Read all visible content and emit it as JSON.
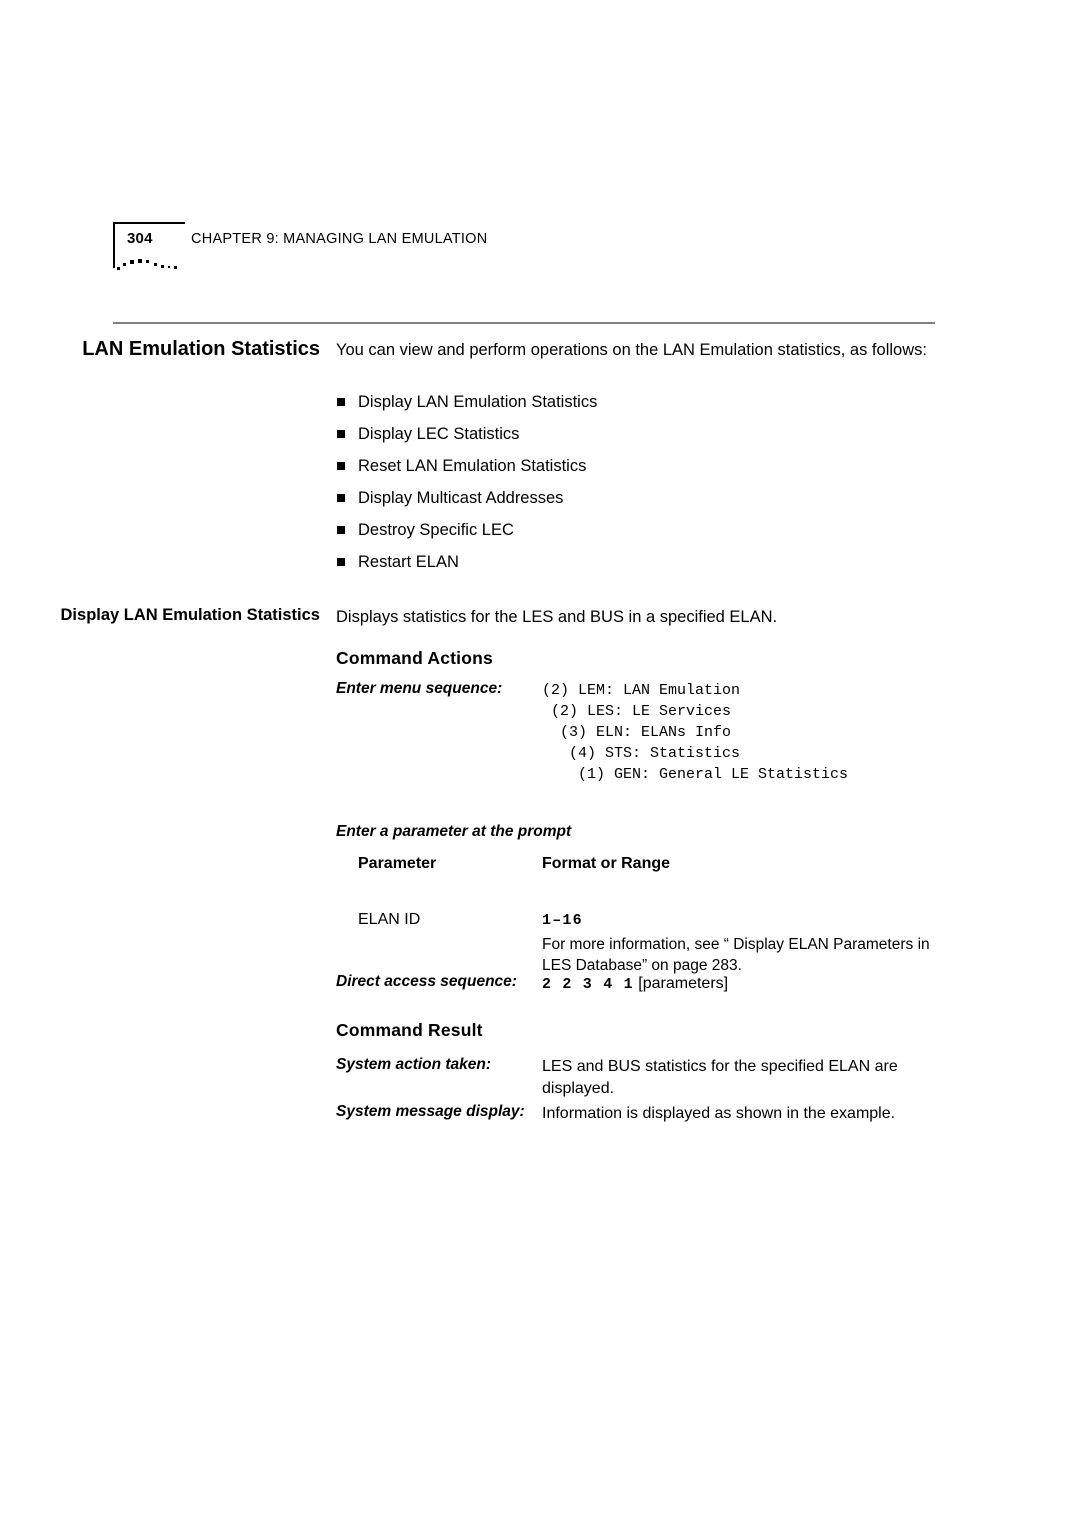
{
  "header": {
    "page_number": "304",
    "chapter_title": "CHAPTER 9: MANAGING LAN EMULATION"
  },
  "section": {
    "side_heading": "LAN Emulation Statistics",
    "intro": "You can view and perform operations on the LAN Emulation statistics, as follows:",
    "bullets": [
      {
        "label": "Display LAN Emulation Statistics"
      },
      {
        "label": "Display LEC Statistics"
      },
      {
        "label": "Reset LAN Emulation Statistics"
      },
      {
        "label": "Display Multicast Addresses"
      },
      {
        "label": "Destroy Specific LEC"
      },
      {
        "label": "Restart ELAN"
      }
    ]
  },
  "subsection": {
    "side_heading": "Display LAN Emulation Statistics",
    "description": "Displays statistics for the LES and BUS in a specified ELAN.",
    "command_actions_heading": "Command Actions",
    "menu_sequence_label": "Enter menu sequence:",
    "menu_sequence": "(2) LEM: LAN Emulation\n (2) LES: LE Services\n  (3) ELN: ELANs Info\n   (4) STS: Statistics\n    (1) GEN: General LE Statistics",
    "parameter_prompt": "Enter a parameter at the prompt",
    "table": {
      "headers": [
        "Parameter",
        "Format or Range"
      ],
      "rows": [
        {
          "parameter": "ELAN ID",
          "range": "1–16",
          "note": "For more information, see “ Display ELAN Parameters in LES Database”  on page 283."
        }
      ]
    },
    "direct_access_label": "Direct access sequence:",
    "direct_access_value": "2 2 3 4 1",
    "direct_access_suffix": "[parameters]",
    "command_result_heading": "Command Result",
    "system_action_label": "System action taken:",
    "system_action_value": "LES and BUS statistics for the specified ELAN are displayed.",
    "system_message_label": "System message display:",
    "system_message_value": "Information is displayed as shown in the example."
  },
  "style": {
    "rule_color": "#808080",
    "text_color": "#000000"
  }
}
